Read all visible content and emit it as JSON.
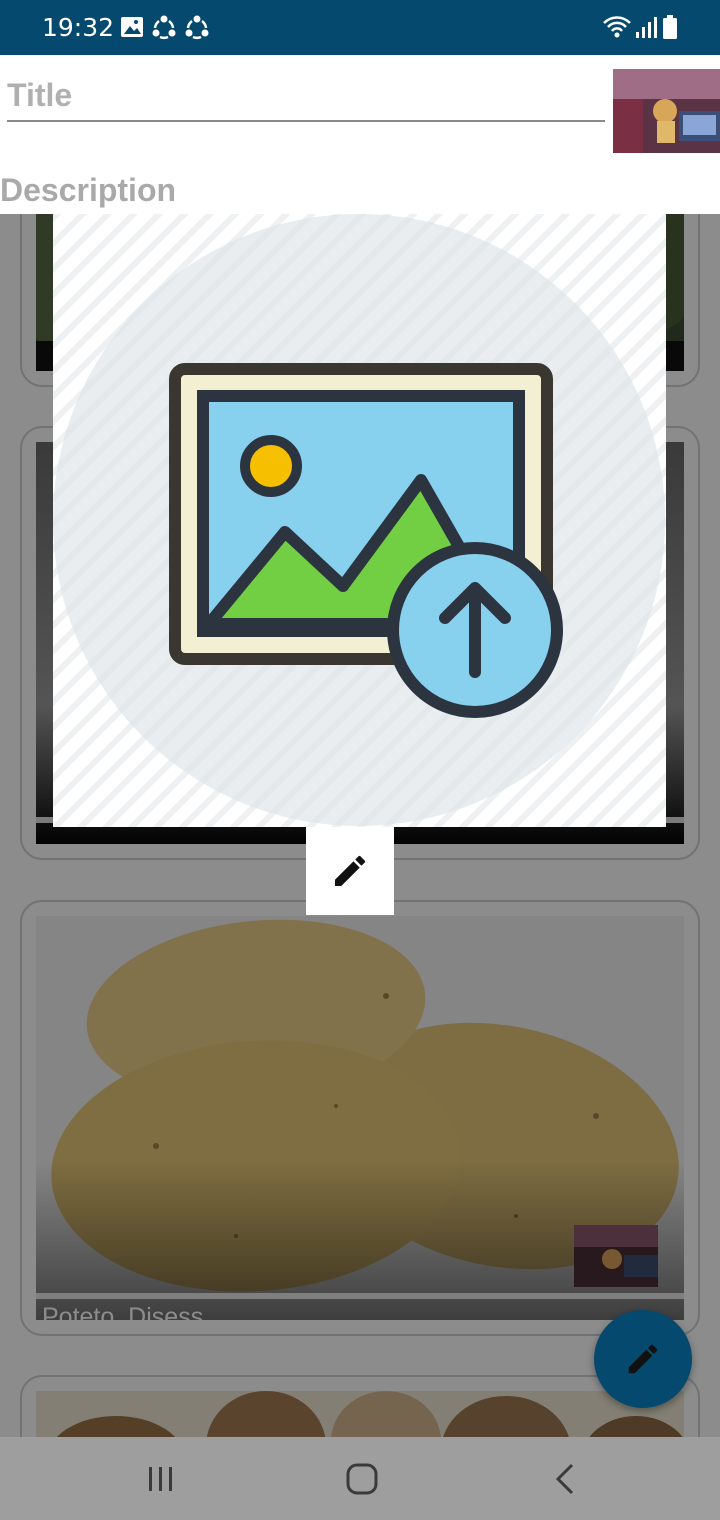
{
  "status_bar": {
    "time": "19:32",
    "left_icons": [
      "image-icon",
      "sync-icon",
      "sync-icon"
    ],
    "right_icons": [
      "wifi-icon",
      "signal-icon",
      "battery-icon"
    ],
    "background": "#05496e"
  },
  "form": {
    "title_placeholder": "Title",
    "title_value": "",
    "description_label": "Description",
    "thumbnail": "photo-thumbnail",
    "upload_image": "image-upload-icon",
    "edit_icon": "pencil-icon"
  },
  "feed": {
    "cards": [
      {
        "label": "",
        "image": "dark-photo"
      },
      {
        "label": "",
        "image": "dark-photo"
      },
      {
        "label": "Poteto_Disess",
        "image": "potatoes-photo",
        "thumbnail": "photo-thumbnail"
      },
      {
        "label": "",
        "image": "potatoes-photo"
      }
    ]
  },
  "fab": {
    "icon": "pencil-icon",
    "color": "#05496e"
  },
  "nav_bar": {
    "buttons": [
      "recent-apps-icon",
      "home-icon",
      "back-icon"
    ]
  }
}
